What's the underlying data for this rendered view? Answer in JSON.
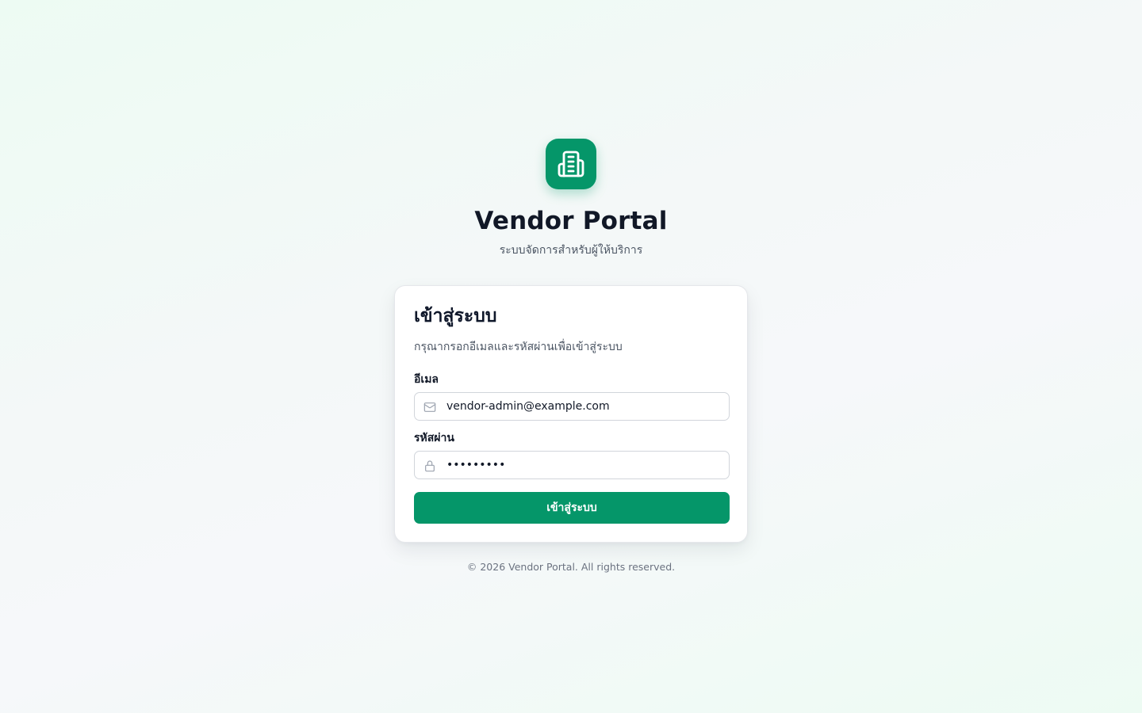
{
  "brand": {
    "title": "Vendor Portal",
    "subtitle": "ระบบจัดการสำหรับผู้ให้บริการ",
    "logo_icon": "building-icon",
    "accent_color": "#059669"
  },
  "login_card": {
    "title": "เข้าสู่ระบบ",
    "description": "กรุณากรอกอีเมลและรหัสผ่านเพื่อเข้าสู่ระบบ",
    "email": {
      "label": "อีเมล",
      "value": "vendor-admin@example.com",
      "icon": "mail-icon"
    },
    "password": {
      "label": "รหัสผ่าน",
      "value": "•••••••••",
      "icon": "lock-icon"
    },
    "submit_label": "เข้าสู่ระบบ"
  },
  "footer": {
    "text": "© 2026 Vendor Portal. All rights reserved."
  }
}
